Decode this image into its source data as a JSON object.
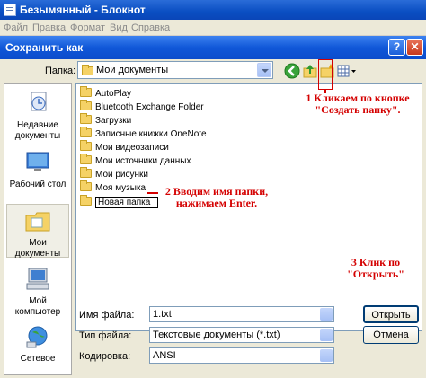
{
  "notepad": {
    "title": "Безымянный - Блокнот",
    "menu": [
      "Файл",
      "Правка",
      "Формат",
      "Вид",
      "Справка"
    ]
  },
  "dialog": {
    "title": "Сохранить как",
    "help_glyph": "?",
    "close_glyph": "✕",
    "folder_label": "Папка:",
    "folder_value": "Мои документы",
    "places": [
      {
        "label": "Недавние документы",
        "icon": "recent-docs-icon"
      },
      {
        "label": "Рабочий стол",
        "icon": "desktop-icon"
      },
      {
        "label": "Мои документы",
        "icon": "my-documents-icon"
      },
      {
        "label": "Мой компьютер",
        "icon": "my-computer-icon"
      },
      {
        "label": "Сетевое",
        "icon": "network-icon"
      }
    ],
    "files": [
      {
        "name": "AutoPlay",
        "icon": "folder-icon"
      },
      {
        "name": "Bluetooth Exchange Folder",
        "icon": "folder-icon"
      },
      {
        "name": "Загрузки",
        "icon": "folder-icon"
      },
      {
        "name": "Записные книжки OneNote",
        "icon": "folder-icon"
      },
      {
        "name": "Мои видеозаписи",
        "icon": "video-folder-icon"
      },
      {
        "name": "Мои источники данных",
        "icon": "data-folder-icon"
      },
      {
        "name": "Мои рисунки",
        "icon": "pictures-folder-icon"
      },
      {
        "name": "Моя музыка",
        "icon": "music-folder-icon"
      },
      {
        "name": "Новая папка",
        "icon": "folder-icon"
      }
    ],
    "filename_label": "Имя файла:",
    "filename_value": "1.txt",
    "filetype_label": "Тип файла:",
    "filetype_value": "Текстовые документы (*.txt)",
    "encoding_label": "Кодировка:",
    "encoding_value": "ANSI",
    "open_label": "Открыть",
    "cancel_label": "Отмена"
  },
  "annotations": {
    "step1": "1 Кликаем по кнопке \"Создать папку\".",
    "step2": "2 Вводим имя папки, нажимаем Enter.",
    "step3": "3 Клик по \"Открыть\""
  },
  "colors": {
    "titlebar": "#0a4ec2",
    "annotation": "#d40000",
    "dialog_bg": "#ece9d8"
  }
}
